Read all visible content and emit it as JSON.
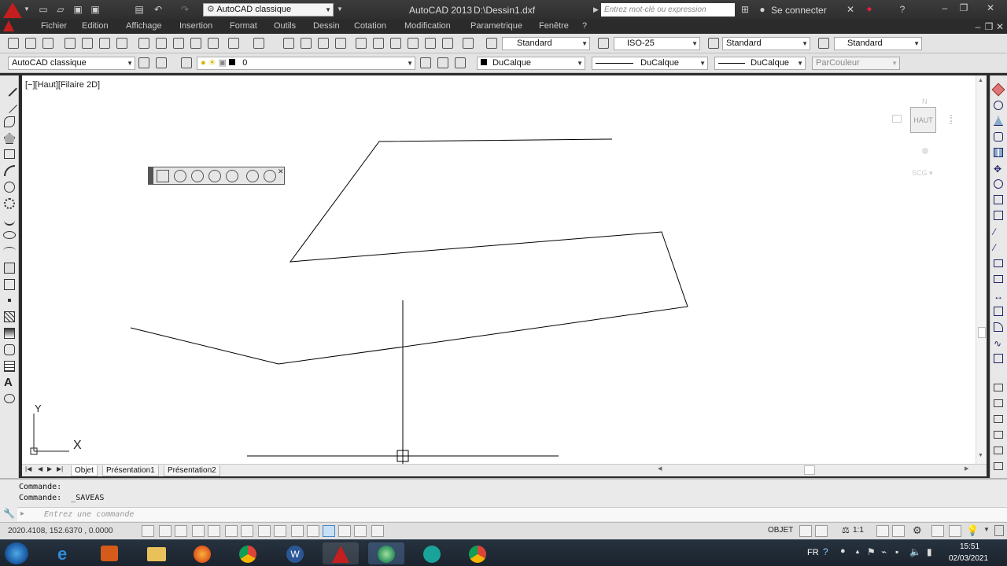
{
  "title_bar": {
    "workspace": "AutoCAD classique",
    "app_title": "AutoCAD 2013",
    "file_path": "D:\\Dessin1.dxf",
    "search_placeholder": "Entrez mot-clé ou expression",
    "sign_in": "Se connecter"
  },
  "menu": [
    "Fichier",
    "Edition",
    "Affichage",
    "Insertion",
    "Format",
    "Outils",
    "Dessin",
    "Cotation",
    "Modification",
    "Parametrique",
    "Fenêtre",
    "?"
  ],
  "styles_toolbar": {
    "text_style": "Standard",
    "dim_style": "ISO-25",
    "table_style": "Standard",
    "mleader_style": "Standard"
  },
  "layers_toolbar": {
    "workspace": "AutoCAD classique",
    "layer": "0",
    "color": "DuCalque",
    "linetype": "DuCalque",
    "lineweight": "DuCalque",
    "plot_style": "ParCouleur"
  },
  "viewport": {
    "label": "[−][Haut][Filaire 2D]",
    "ucs_x": "X",
    "ucs_y": "Y",
    "viewcube_face": "HAUT",
    "viewcube_top": "N",
    "wcs_label": "SCG ▾"
  },
  "tabs": [
    "Objet",
    "Présentation1",
    "Présentation2"
  ],
  "command": {
    "history": [
      "Commande:",
      "Commande:  _SAVEAS"
    ],
    "placeholder": "Entrez une commande"
  },
  "status": {
    "coords": "2020.4108, 152.6370 , 0.0000",
    "model_label": "OBJET",
    "scale": "1:1"
  },
  "taskbar": {
    "lang": "FR",
    "time": "15:51",
    "date": "02/03/2021"
  },
  "colors": {
    "accent_cad": "#c41e1e",
    "viewport_bg": "#ffffff",
    "toolbar_bg": "#e4e4e4"
  }
}
